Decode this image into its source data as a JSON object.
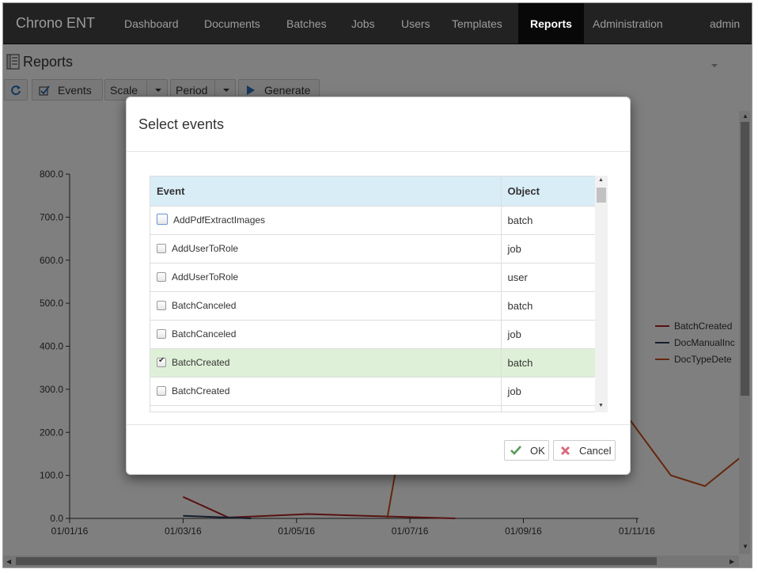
{
  "app": {
    "brand": "Chrono ENT",
    "nav": [
      "Dashboard",
      "Documents",
      "Batches",
      "Jobs",
      "Users",
      "Templates",
      "Reports",
      "Administration"
    ],
    "active_nav": "Reports",
    "user_menu": "admin"
  },
  "page": {
    "title": "Reports"
  },
  "toolbar": {
    "events_label": "Events",
    "scale_label": "Scale",
    "period_label": "Period",
    "generate_label": "Generate"
  },
  "chart_data": {
    "type": "line",
    "x": [
      "01/01/16",
      "01/03/16",
      "01/05/16",
      "01/07/16",
      "01/09/16",
      "01/11/16"
    ],
    "ylim": [
      0,
      800
    ],
    "yticks": [
      "800.0",
      "700.0",
      "600.0",
      "500.0",
      "400.0",
      "300.0",
      "200.0",
      "100.0",
      "0.0"
    ],
    "series": [
      {
        "name": "BatchCreated",
        "legend_text": "BatchCreated",
        "color": "#b22222",
        "points": [
          [
            1.0,
            50
          ],
          [
            1.4,
            2
          ],
          [
            2.1,
            10
          ],
          [
            2.6,
            6
          ],
          [
            3.4,
            0
          ]
        ]
      },
      {
        "name": "DocManualInd",
        "legend_text": "DocManualInc",
        "color": "#2a3a5a",
        "points": [
          [
            1.0,
            6
          ],
          [
            1.6,
            0
          ]
        ]
      },
      {
        "name": "DocTypeDete",
        "legend_text": "DocTypeDete",
        "color": "#c8501a",
        "points": [
          [
            2.8,
            0
          ],
          [
            3.2,
            600
          ],
          [
            4.6,
            350
          ],
          [
            5.3,
            100
          ],
          [
            5.6,
            75
          ],
          [
            6.0,
            160
          ]
        ]
      }
    ]
  },
  "dialog": {
    "title": "Select events",
    "columns": [
      "Event",
      "Object"
    ],
    "rows": [
      {
        "event": "AddPdfExtractImages",
        "object": "batch",
        "checked": false
      },
      {
        "event": "AddUserToRole",
        "object": "job",
        "checked": false
      },
      {
        "event": "AddUserToRole",
        "object": "user",
        "checked": false
      },
      {
        "event": "BatchCanceled",
        "object": "batch",
        "checked": false
      },
      {
        "event": "BatchCanceled",
        "object": "job",
        "checked": false
      },
      {
        "event": "BatchCreated",
        "object": "batch",
        "checked": true
      },
      {
        "event": "BatchCreated",
        "object": "job",
        "checked": false
      },
      {
        "event": "",
        "object": "",
        "checked": false
      }
    ],
    "ok_label": "OK",
    "cancel_label": "Cancel"
  }
}
